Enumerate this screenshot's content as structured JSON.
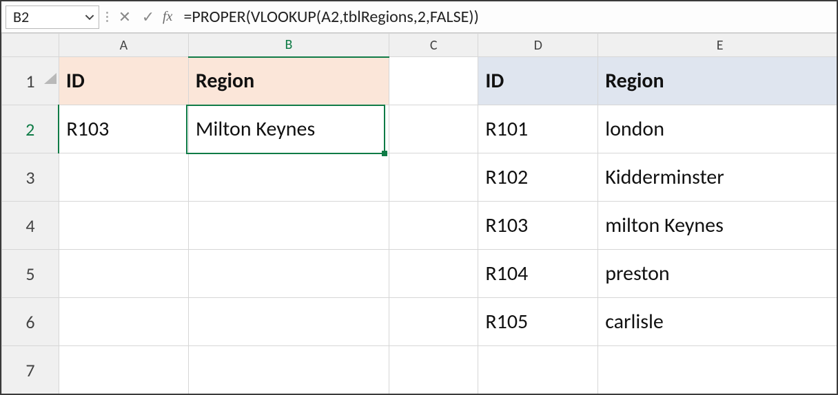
{
  "formula_bar": {
    "cell_ref": "B2",
    "formula": "=PROPER(VLOOKUP(A2,tblRegions,2,FALSE))",
    "fx_label": "fx",
    "cancel_icon": "✕",
    "enter_icon": "✓"
  },
  "columns": {
    "A": "A",
    "B": "B",
    "C": "C",
    "D": "D",
    "E": "E"
  },
  "rows": [
    "1",
    "2",
    "3",
    "4",
    "5",
    "6",
    "7"
  ],
  "cells": {
    "A1": "ID",
    "B1": "Region",
    "D1": "ID",
    "E1": "Region",
    "A2": "R103",
    "B2": "Milton Keynes",
    "D2": "R101",
    "E2": "london",
    "D3": "R102",
    "E3": "Kidderminster",
    "D4": "R103",
    "E4": "milton Keynes",
    "D5": "R104",
    "E5": "preston",
    "D6": "R105",
    "E6": "carlisle"
  },
  "active_cell": "B2",
  "chart_data": {
    "type": "table",
    "left_table": {
      "headers": [
        "ID",
        "Region"
      ],
      "rows": [
        [
          "R103",
          "Milton Keynes"
        ]
      ]
    },
    "right_table": {
      "headers": [
        "ID",
        "Region"
      ],
      "rows": [
        [
          "R101",
          "london"
        ],
        [
          "R102",
          "Kidderminster"
        ],
        [
          "R103",
          "milton Keynes"
        ],
        [
          "R104",
          "preston"
        ],
        [
          "R105",
          "carlisle"
        ]
      ]
    }
  }
}
